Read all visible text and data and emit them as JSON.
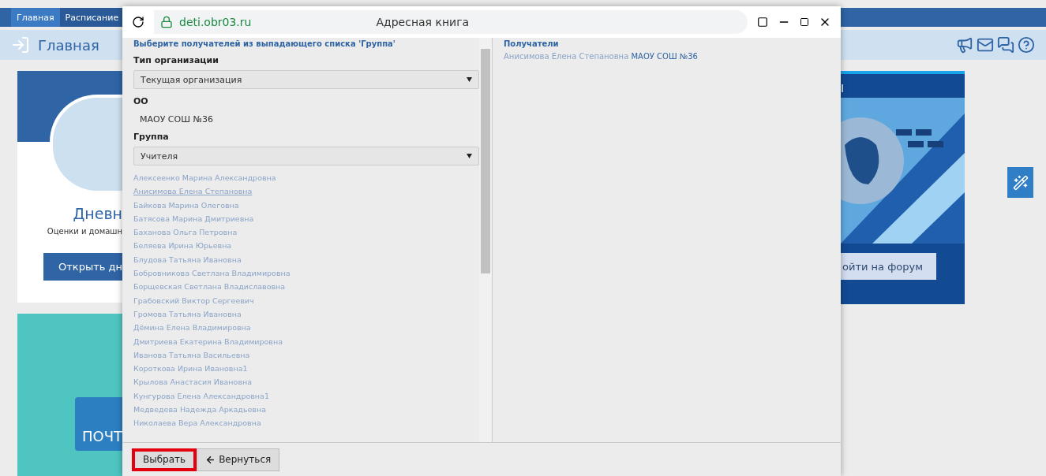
{
  "nav_tabs": [
    {
      "label": "Главная",
      "selected": true
    },
    {
      "label": "Расписание",
      "selected": false
    }
  ],
  "header": {
    "title": "Главная"
  },
  "diary_card": {
    "title": "Дневн",
    "subtitle": "Оценки и домашн",
    "button": "Открыть дн"
  },
  "mail_card": {
    "label": "ПОЧТ"
  },
  "forum_card": {
    "title": "I",
    "button": "ойти на форум"
  },
  "popup": {
    "url": "deti.obr03.ru",
    "title": "Адресная книга",
    "hint": "Выберите получателей из выпадающего списка 'Группа'",
    "org_type_label": "Тип организации",
    "org_type_value": "Текущая организация",
    "oo_label": "ОО",
    "oo_value": "МАОУ СОШ №36",
    "group_label": "Группа",
    "group_value": "Учителя",
    "people": [
      {
        "name": "Алексеенко Марина Александровна",
        "selected": false
      },
      {
        "name": "Анисимова Елена Степановна",
        "selected": true
      },
      {
        "name": "Байкова Марина Олеговна",
        "selected": false
      },
      {
        "name": "Батясова Марина Дмитриевна",
        "selected": false
      },
      {
        "name": "Баханова Ольга Петровна",
        "selected": false
      },
      {
        "name": "Беляева Ирина Юрьевна",
        "selected": false
      },
      {
        "name": "Блудова Татьяна Ивановна",
        "selected": false
      },
      {
        "name": "Бобровникова Светлана Владимировна",
        "selected": false
      },
      {
        "name": "Борщевская Светлана Владиславовна",
        "selected": false
      },
      {
        "name": "Грабовский Виктор Сергеевич",
        "selected": false
      },
      {
        "name": "Громова Татьяна Ивановна",
        "selected": false
      },
      {
        "name": "Дёмина Елена Владимировна",
        "selected": false
      },
      {
        "name": "Дмитриева Екатерина Владимировна",
        "selected": false
      },
      {
        "name": "Иванова Татьяна Васильевна",
        "selected": false
      },
      {
        "name": "Короткова Ирина Ивановна1",
        "selected": false
      },
      {
        "name": "Крылова Анастасия Ивановна",
        "selected": false
      },
      {
        "name": "Кунгурова Елена Александровна1",
        "selected": false
      },
      {
        "name": "Медведева Надежда Аркадьевна",
        "selected": false
      },
      {
        "name": "Николаева Вера Александровна",
        "selected": false
      }
    ],
    "recipients_label": "Получатели",
    "recipients": [
      {
        "name": "Анисимова Елена Степановна",
        "org": "МАОУ СОШ №36"
      }
    ],
    "select_button": "Выбрать",
    "back_button": "Вернуться"
  }
}
